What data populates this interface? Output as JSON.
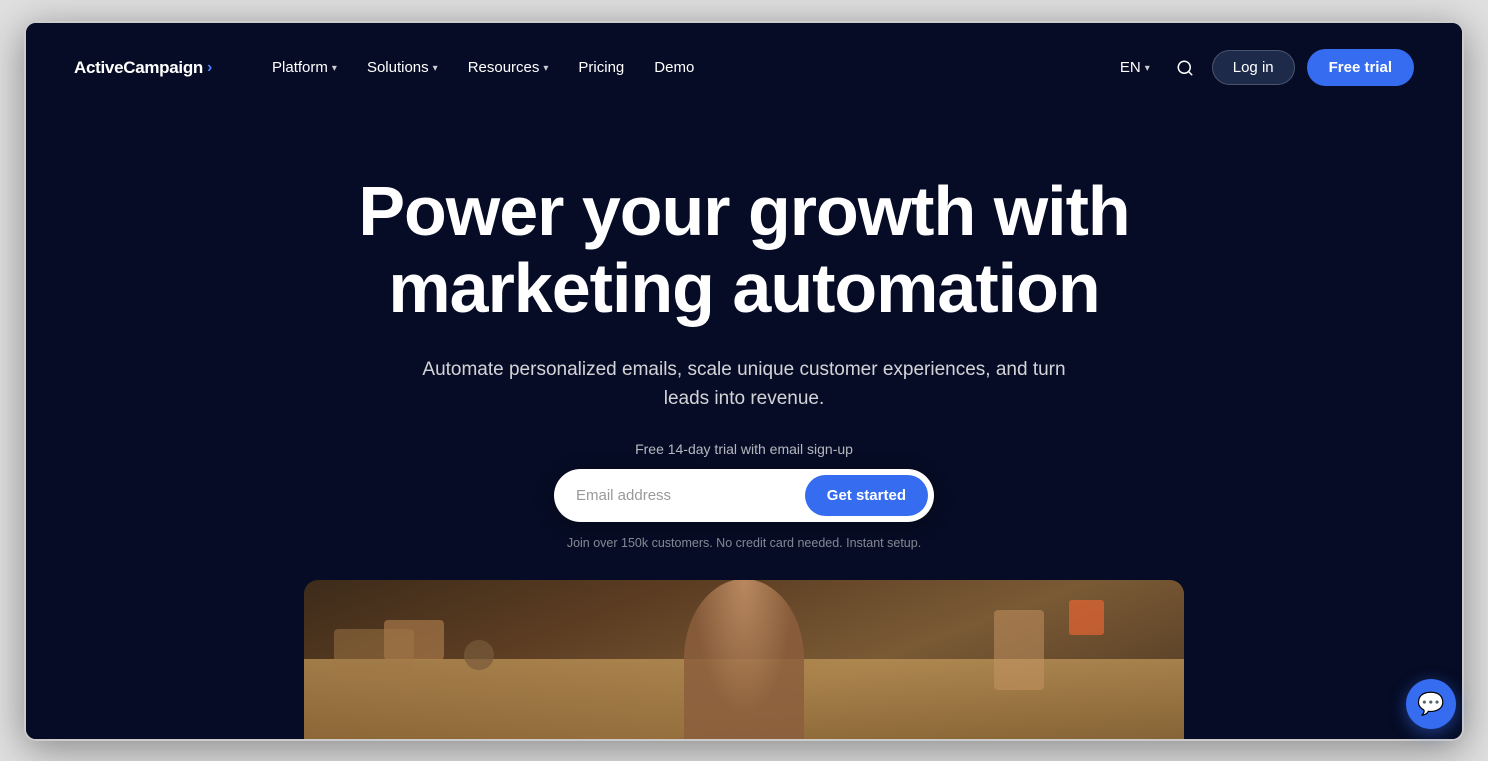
{
  "brand": {
    "name": "ActiveCampaign",
    "arrow": "›"
  },
  "navbar": {
    "links": [
      {
        "id": "platform",
        "label": "Platform",
        "hasDropdown": true
      },
      {
        "id": "solutions",
        "label": "Solutions",
        "hasDropdown": true
      },
      {
        "id": "resources",
        "label": "Resources",
        "hasDropdown": true
      },
      {
        "id": "pricing",
        "label": "Pricing",
        "hasDropdown": false
      },
      {
        "id": "demo",
        "label": "Demo",
        "hasDropdown": false
      }
    ],
    "language": "EN",
    "login_label": "Log in",
    "trial_label": "Free trial"
  },
  "hero": {
    "title": "Power your growth with marketing automation",
    "subtitle": "Automate personalized emails, scale unique customer experiences, and turn leads into revenue.",
    "trial_text": "Free 14-day trial with email sign-up",
    "email_placeholder": "Email address",
    "cta_label": "Get started",
    "social_proof": "Join over 150k customers. No credit card needed. Instant setup."
  },
  "colors": {
    "bg": "#060c25",
    "accent": "#356cf0",
    "nav_bg": "#060c25"
  }
}
